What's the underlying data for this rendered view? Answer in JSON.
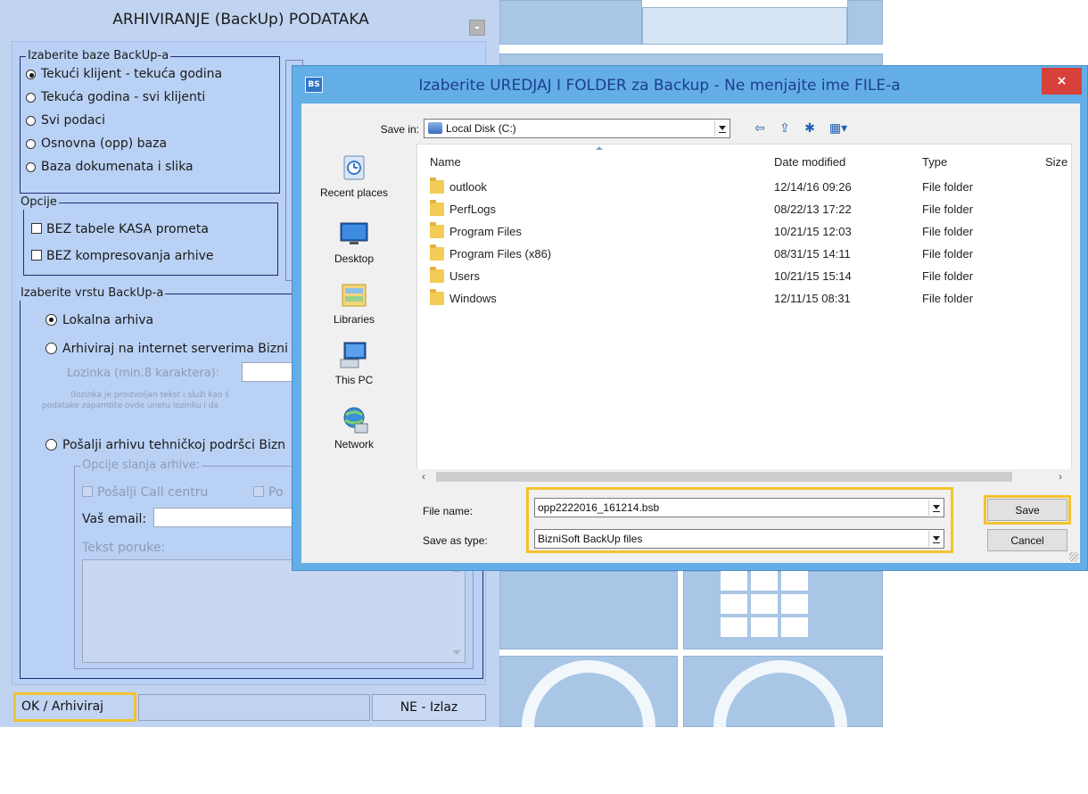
{
  "panel": {
    "title": "ARHIVIRANJE (BackUp)  PODATAKA",
    "group_bases": {
      "legend": "Izaberite baze BackUp-a",
      "options": [
        "Tekući klijent - tekuća godina",
        "Tekuća godina - svi klijenti",
        "Svi podaci",
        "Osnovna (opp) baza",
        "Baza dokumenata i slika"
      ],
      "selected": 0
    },
    "group_options": {
      "legend": "Opcije",
      "checks": [
        "BEZ tabele KASA prometa",
        "BEZ kompresovanja arhive"
      ]
    },
    "group_type": {
      "legend": "Izaberite vrstu BackUp-a",
      "local": "Lokalna arhiva",
      "internet": "Arhiviraj na internet serverima Bizni",
      "password_label": "Lozinka (min.8 karaktera):",
      "note_line1": "(lozinka je proizvoljan tekst i služi kao ś",
      "note_line2": "podatake zapamtite ovde unetu lozinku i da",
      "support": "Pošalji arhivu tehničkoj podršci Bizn",
      "send_options_legend": "Opcije slanja arhive:",
      "send_call_center": "Pošalji Call centru",
      "send_other": "Po",
      "email_label": "Vaš email:",
      "message_label": "Tekst poruke:"
    },
    "buttons": {
      "ok": "OK / Arhiviraj",
      "exit": "NE - Izlaz"
    }
  },
  "dialog": {
    "app_icon": "BS",
    "title": "Izaberite UREDJAJ I FOLDER za Backup - Ne menjajte ime FILE-a",
    "close": "×",
    "save_in_label": "Save in:",
    "save_in_value": "Local Disk (C:)",
    "places": [
      "Recent places",
      "Desktop",
      "Libraries",
      "This PC",
      "Network"
    ],
    "columns": [
      "Name",
      "Date modified",
      "Type",
      "Size"
    ],
    "files": [
      {
        "name": "outlook",
        "date": "12/14/16 09:26",
        "type": "File folder"
      },
      {
        "name": "PerfLogs",
        "date": "08/22/13 17:22",
        "type": "File folder"
      },
      {
        "name": "Program Files",
        "date": "10/21/15 12:03",
        "type": "File folder"
      },
      {
        "name": "Program Files (x86)",
        "date": "08/31/15 14:11",
        "type": "File folder"
      },
      {
        "name": "Users",
        "date": "10/21/15 15:14",
        "type": "File folder"
      },
      {
        "name": "Windows",
        "date": "12/11/15 08:31",
        "type": "File folder"
      }
    ],
    "file_name_label": "File name:",
    "file_name_value": "opp2222016_161214.bsb",
    "save_type_label": "Save as type:",
    "save_type_value": "BizniSoft BackUp files",
    "save_button": "Save",
    "cancel_button": "Cancel"
  },
  "colors": {
    "highlight": "#f2c231",
    "panel_bg": "#c0d3f0",
    "dialog_frame": "#64aee7",
    "close_red": "#d8413a"
  }
}
